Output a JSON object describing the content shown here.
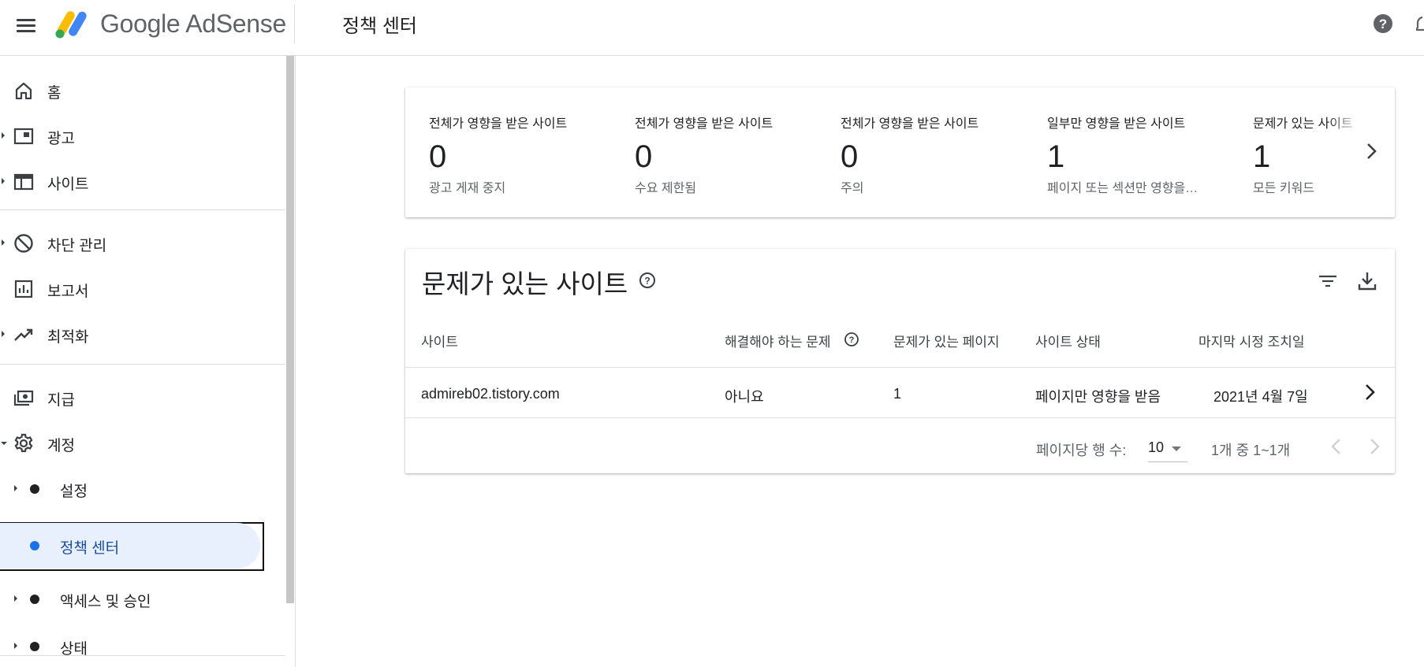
{
  "header": {
    "brand": "Google AdSense",
    "page_title": "정책 센터",
    "icons": [
      "menu-icon",
      "adsense-logo",
      "help-icon",
      "notifications-icon"
    ]
  },
  "sidebar": {
    "items": [
      {
        "label": "홈",
        "icon": "home-icon"
      },
      {
        "label": "광고",
        "icon": "ads-icon"
      },
      {
        "label": "사이트",
        "icon": "sites-icon"
      },
      {
        "label": "차단 관리",
        "icon": "block-icon"
      },
      {
        "label": "보고서",
        "icon": "reports-icon"
      },
      {
        "label": "최적화",
        "icon": "trending-icon"
      },
      {
        "label": "지급",
        "icon": "payments-icon"
      },
      {
        "label": "계정",
        "icon": "gear-icon"
      }
    ],
    "sub_items": [
      {
        "label": "설정"
      },
      {
        "label": "정책 센터",
        "active": true
      },
      {
        "label": "액세스 및 승인"
      },
      {
        "label": "상태"
      }
    ]
  },
  "summary": {
    "stats": [
      {
        "label": "전체가 영향을 받은 사이트",
        "value": "0",
        "sub": "광고 게재 중지"
      },
      {
        "label": "전체가 영향을 받은 사이트",
        "value": "0",
        "sub": "수요 제한됨"
      },
      {
        "label": "전체가 영향을 받은 사이트",
        "value": "0",
        "sub": "주의"
      },
      {
        "label": "일부만 영향을 받은 사이트",
        "value": "1",
        "sub": "페이지 또는 섹션만 영향을 받음"
      },
      {
        "label": "문제가 있는 사이트",
        "value": "1",
        "sub": "모든 키워드"
      }
    ]
  },
  "sites_table": {
    "title": "문제가 있는 사이트",
    "columns": [
      "사이트",
      "해결해야 하는 문제",
      "문제가 있는 페이지",
      "사이트 상태",
      "마지막 시정 조치일"
    ],
    "rows": [
      {
        "site": "admireb02.tistory.com",
        "must_fix": "아니요",
        "pages": "1",
        "status": "페이지만 영향을 받음",
        "last_action": "2021년 4월 7일"
      }
    ],
    "pagination": {
      "rows_per_page_label": "페이지당 행 수:",
      "rows_per_page": "10",
      "range": "1개 중 1~1개"
    }
  },
  "colors": {
    "accent": "#1a73e8",
    "active_bg": "#e8f0fe",
    "text": "#202124",
    "muted": "#5f6368"
  }
}
